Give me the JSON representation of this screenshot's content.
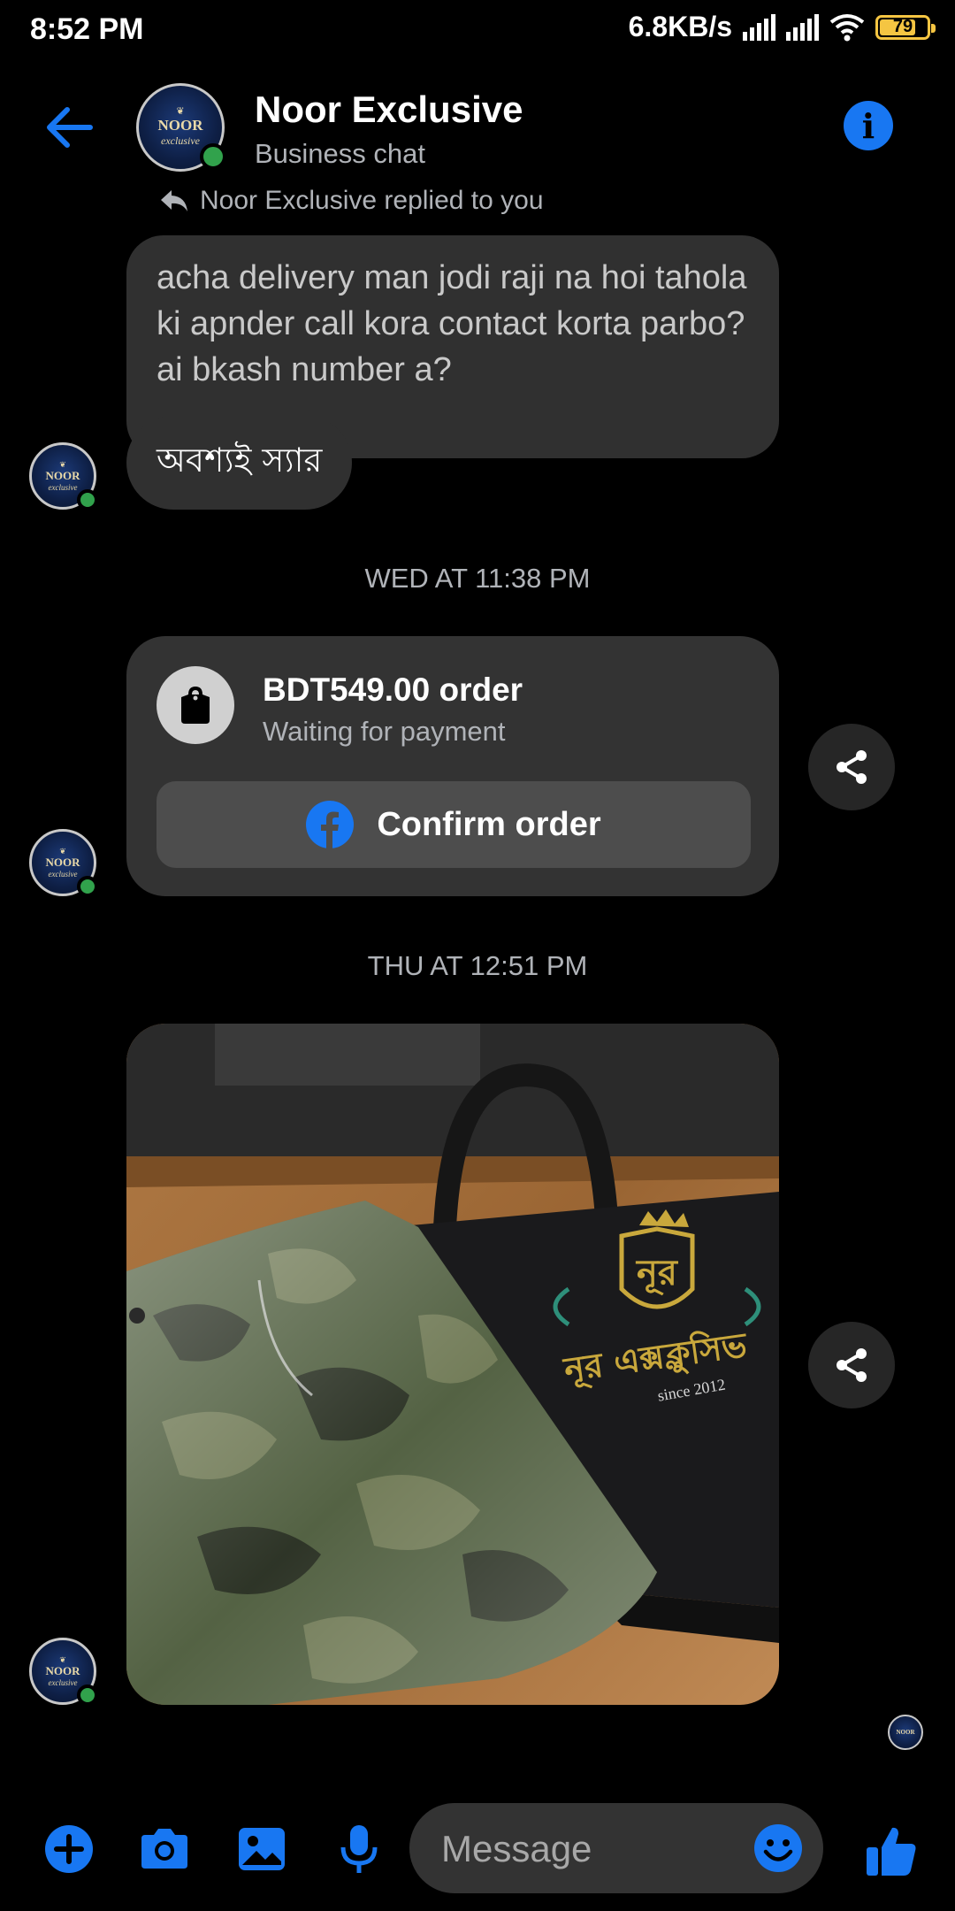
{
  "status_bar": {
    "time": "8:52 PM",
    "net_speed": "6.8KB/s",
    "battery": "79",
    "battery_level": 0.79
  },
  "header": {
    "title": "Noor Exclusive",
    "subtitle": "Business chat",
    "back_icon": "arrow-left-icon",
    "info_icon": "info-icon",
    "info_glyph": "i"
  },
  "avatar": {
    "logo_main": "NOOR",
    "logo_sub": "exclusive"
  },
  "conversation": {
    "reply_indicator": "Noor Exclusive  replied to you",
    "quoted_message": "acha delivery man jodi raji na hoi tahola ki apnder call kora contact korta parbo? ai bkash number a?",
    "reply_message": "অবশ্যই স্যার",
    "timestamp_1": "WED AT 11:38 PM",
    "order": {
      "title": "BDT549.00 order",
      "status": "Waiting for payment",
      "button_label": "Confirm order",
      "icon": "shopping-bag-icon"
    },
    "timestamp_2": "THU AT 12:51 PM",
    "photo": {
      "bag_text_bn": "নূর",
      "bag_brand_bn": "নূর এক্সক্লুসিভ",
      "bag_since": "since 2012"
    }
  },
  "composer": {
    "placeholder": "Message",
    "icons": [
      "plus-icon",
      "camera-icon",
      "image-icon",
      "microphone-icon",
      "emoji-icon",
      "thumbs-up-icon"
    ]
  },
  "colors": {
    "accent": "#1877f2",
    "online": "#31a24c",
    "bubble": "#303030"
  }
}
